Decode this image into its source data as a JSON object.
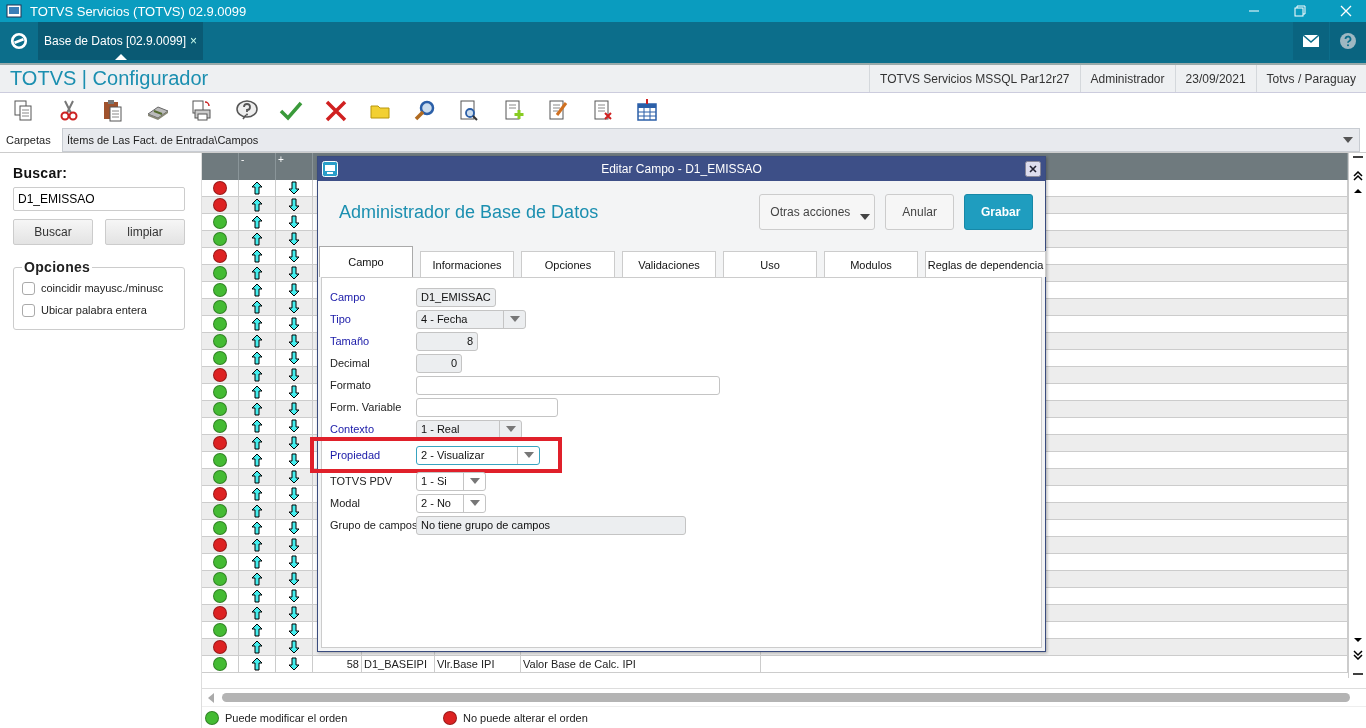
{
  "window": {
    "title": "TOTVS Servicios (TOTVS) 02.9.0099"
  },
  "tabs": [
    {
      "label": "Base de Datos [02.9.0099]",
      "close": "×",
      "selected": true
    }
  ],
  "app_header": {
    "title": "TOTVS | Configurador",
    "info": [
      "TOTVS Servicios MSSQL Par12r27",
      "Administrador",
      "23/09/2021",
      "Totvs / Paraguay"
    ]
  },
  "carpetas": {
    "label": "Carpetas",
    "value": "Ítems de Las Fact. de Entrada\\Campos"
  },
  "search": {
    "title": "Buscar:",
    "value": "D1_EMISSAO",
    "buttons": [
      "Buscar",
      "limpiar"
    ],
    "options_title": "Opciones",
    "options": [
      {
        "label": "coincidir mayusc./minusc",
        "checked": false
      },
      {
        "label": "Ubicar palabra entera",
        "checked": false
      }
    ]
  },
  "grid": {
    "columns": [
      "",
      "-",
      "+"
    ],
    "rows": [
      {
        "color": "#dd2222"
      },
      {
        "color": "#dd2222"
      },
      {
        "color": "#44bb33"
      },
      {
        "color": "#44bb33"
      },
      {
        "color": "#dd2222"
      },
      {
        "color": "#44bb33"
      },
      {
        "color": "#44bb33"
      },
      {
        "color": "#44bb33"
      },
      {
        "color": "#44bb33"
      },
      {
        "color": "#44bb33"
      },
      {
        "color": "#44bb33"
      },
      {
        "color": "#dd2222"
      },
      {
        "color": "#44bb33"
      },
      {
        "color": "#44bb33"
      },
      {
        "color": "#44bb33"
      },
      {
        "color": "#dd2222"
      },
      {
        "color": "#44bb33"
      },
      {
        "color": "#44bb33"
      },
      {
        "color": "#dd2222"
      },
      {
        "color": "#44bb33"
      },
      {
        "color": "#44bb33"
      },
      {
        "color": "#dd2222"
      },
      {
        "color": "#44bb33"
      },
      {
        "color": "#44bb33"
      },
      {
        "color": "#44bb33"
      },
      {
        "color": "#dd2222"
      },
      {
        "color": "#44bb33"
      },
      {
        "color": "#dd2222"
      },
      {
        "color": "#44bb33",
        "cells": [
          "58",
          "D1_BASEIPI",
          "Vlr.Base IPI",
          "Valor Base de Calc. IPI"
        ]
      }
    ]
  },
  "dialog": {
    "title": "Editar Campo - D1_EMISSAO",
    "heading": "Administrador de Base de Datos",
    "buttons": [
      {
        "label": "Otras acciones",
        "kind": "menu"
      },
      {
        "label": "Anular",
        "kind": "normal"
      },
      {
        "label": "Grabar",
        "kind": "primary"
      }
    ],
    "tabs": [
      {
        "label": "Campo",
        "selected": true
      },
      {
        "label": "Informaciones",
        "selected": false
      },
      {
        "label": "Opciones",
        "selected": false
      },
      {
        "label": "Validaciones",
        "selected": false
      },
      {
        "label": "Uso",
        "selected": false
      },
      {
        "label": "Modulos",
        "selected": false
      },
      {
        "label": "Reglas de dependencia",
        "selected": false
      }
    ],
    "fields": [
      {
        "label": "Campo",
        "required": true,
        "kind": "text",
        "value": "D1_EMISSAC",
        "readonly": true
      },
      {
        "label": "Tipo",
        "required": true,
        "kind": "select",
        "value": "4 - Fecha",
        "readonly": true
      },
      {
        "label": "Tamaño",
        "required": true,
        "kind": "number",
        "value": "8",
        "readonly": true
      },
      {
        "label": "Decimal",
        "required": false,
        "kind": "number",
        "value": "0",
        "readonly": true
      },
      {
        "label": "Formato",
        "required": false,
        "kind": "text",
        "readonly": false
      },
      {
        "label": "Form. Variable",
        "required": false,
        "kind": "text",
        "readonly": false
      },
      {
        "label": "Contexto",
        "required": true,
        "kind": "select",
        "value": "1 - Real",
        "readonly": true
      },
      {
        "label": "Propiedad",
        "required": true,
        "kind": "select",
        "value": "2 - Visualizar",
        "readonly": false,
        "highlighted": true
      },
      {
        "label": "TOTVS PDV",
        "required": false,
        "kind": "select",
        "value": "1 - Si",
        "readonly": false
      },
      {
        "label": "Modal",
        "required": false,
        "kind": "select",
        "value": "2 - No",
        "readonly": false
      },
      {
        "label": "Grupo de campos",
        "required": false,
        "kind": "text",
        "value": "No tiene grupo de campos",
        "readonly": true
      }
    ]
  },
  "legend": [
    {
      "label": "Puede modificar el orden",
      "color": "#44bb33"
    },
    {
      "label": "No puede alterar el orden",
      "color": "#dd2222"
    }
  ]
}
